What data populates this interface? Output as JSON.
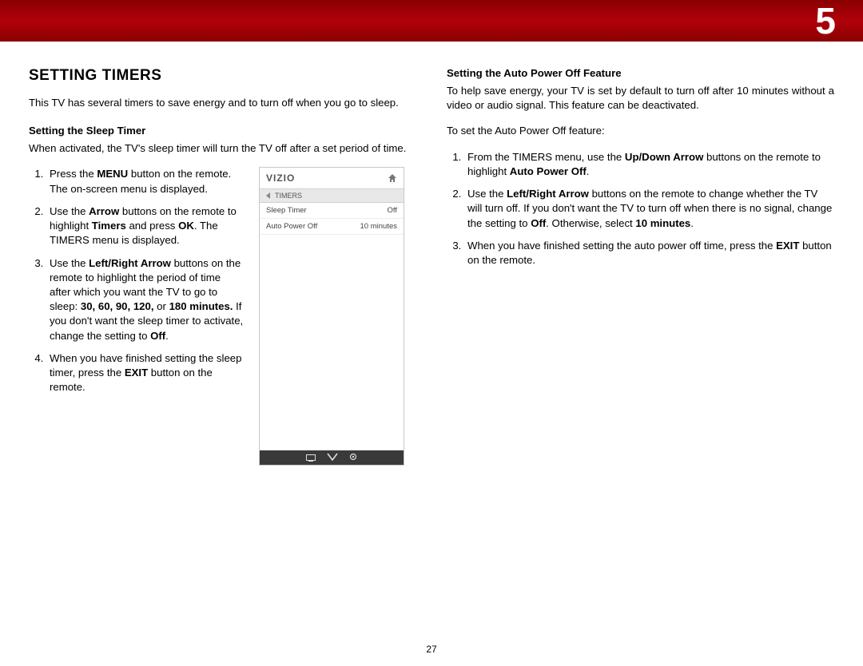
{
  "chapter_number": "5",
  "page_number": "27",
  "left": {
    "heading": "SETTING TIMERS",
    "intro": "This TV has several timers to save energy and to turn off when you go to sleep.",
    "sub1": "Setting the Sleep Timer",
    "sub1_body": "When activated, the TV's sleep timer will turn the TV off after a set period of time.",
    "step1_a": "Press the ",
    "step1_b": "MENU",
    "step1_c": " button on the remote. The on-screen menu is displayed.",
    "step2_a": "Use the ",
    "step2_b": "Arrow",
    "step2_c": " buttons on the remote to highlight ",
    "step2_d": "Timers",
    "step2_e": " and press ",
    "step2_f": "OK",
    "step2_g": ". The TIMERS menu is displayed.",
    "step3_a": "Use the ",
    "step3_b": "Left/Right Arrow",
    "step3_c": " buttons on the remote to highlight the period of time after which you want the TV to go to sleep: ",
    "step3_d": "30, 60, 90, 120,",
    "step3_e": " or ",
    "step3_f": "180 minutes.",
    "step3_g": " If you don't want the sleep timer to activate, change the setting to ",
    "step3_h": "Off",
    "step3_i": ".",
    "step4_a": "When you have finished setting the sleep timer, press the ",
    "step4_b": "EXIT",
    "step4_c": " button on the remote."
  },
  "vizio": {
    "logo": "VIZIO",
    "crumb": "TIMERS",
    "row1_label": "Sleep Timer",
    "row1_value": "Off",
    "row2_label": "Auto Power Off",
    "row2_value": "10 minutes"
  },
  "right": {
    "sub": "Setting the Auto Power Off Feature",
    "intro": "To help save energy, your TV is set by default to turn off after 10 minutes without a video or audio signal. This feature can be deactivated.",
    "lead": "To set the Auto Power Off feature:",
    "r1_a": "From the TIMERS menu, use the ",
    "r1_b": "Up/Down Arrow",
    "r1_c": " buttons on the remote to highlight ",
    "r1_d": "Auto Power Off",
    "r1_e": ".",
    "r2_a": "Use the ",
    "r2_b": "Left/Right Arrow",
    "r2_c": " buttons on the remote to change whether the TV will turn off. If you don't want the TV to turn off when there is no signal, change the setting to ",
    "r2_d": "Off",
    "r2_e": ". Otherwise, select ",
    "r2_f": "10 minutes",
    "r2_g": ".",
    "r3_a": "When you have finished setting the auto power off time, press the ",
    "r3_b": "EXIT",
    "r3_c": " button on the remote."
  }
}
